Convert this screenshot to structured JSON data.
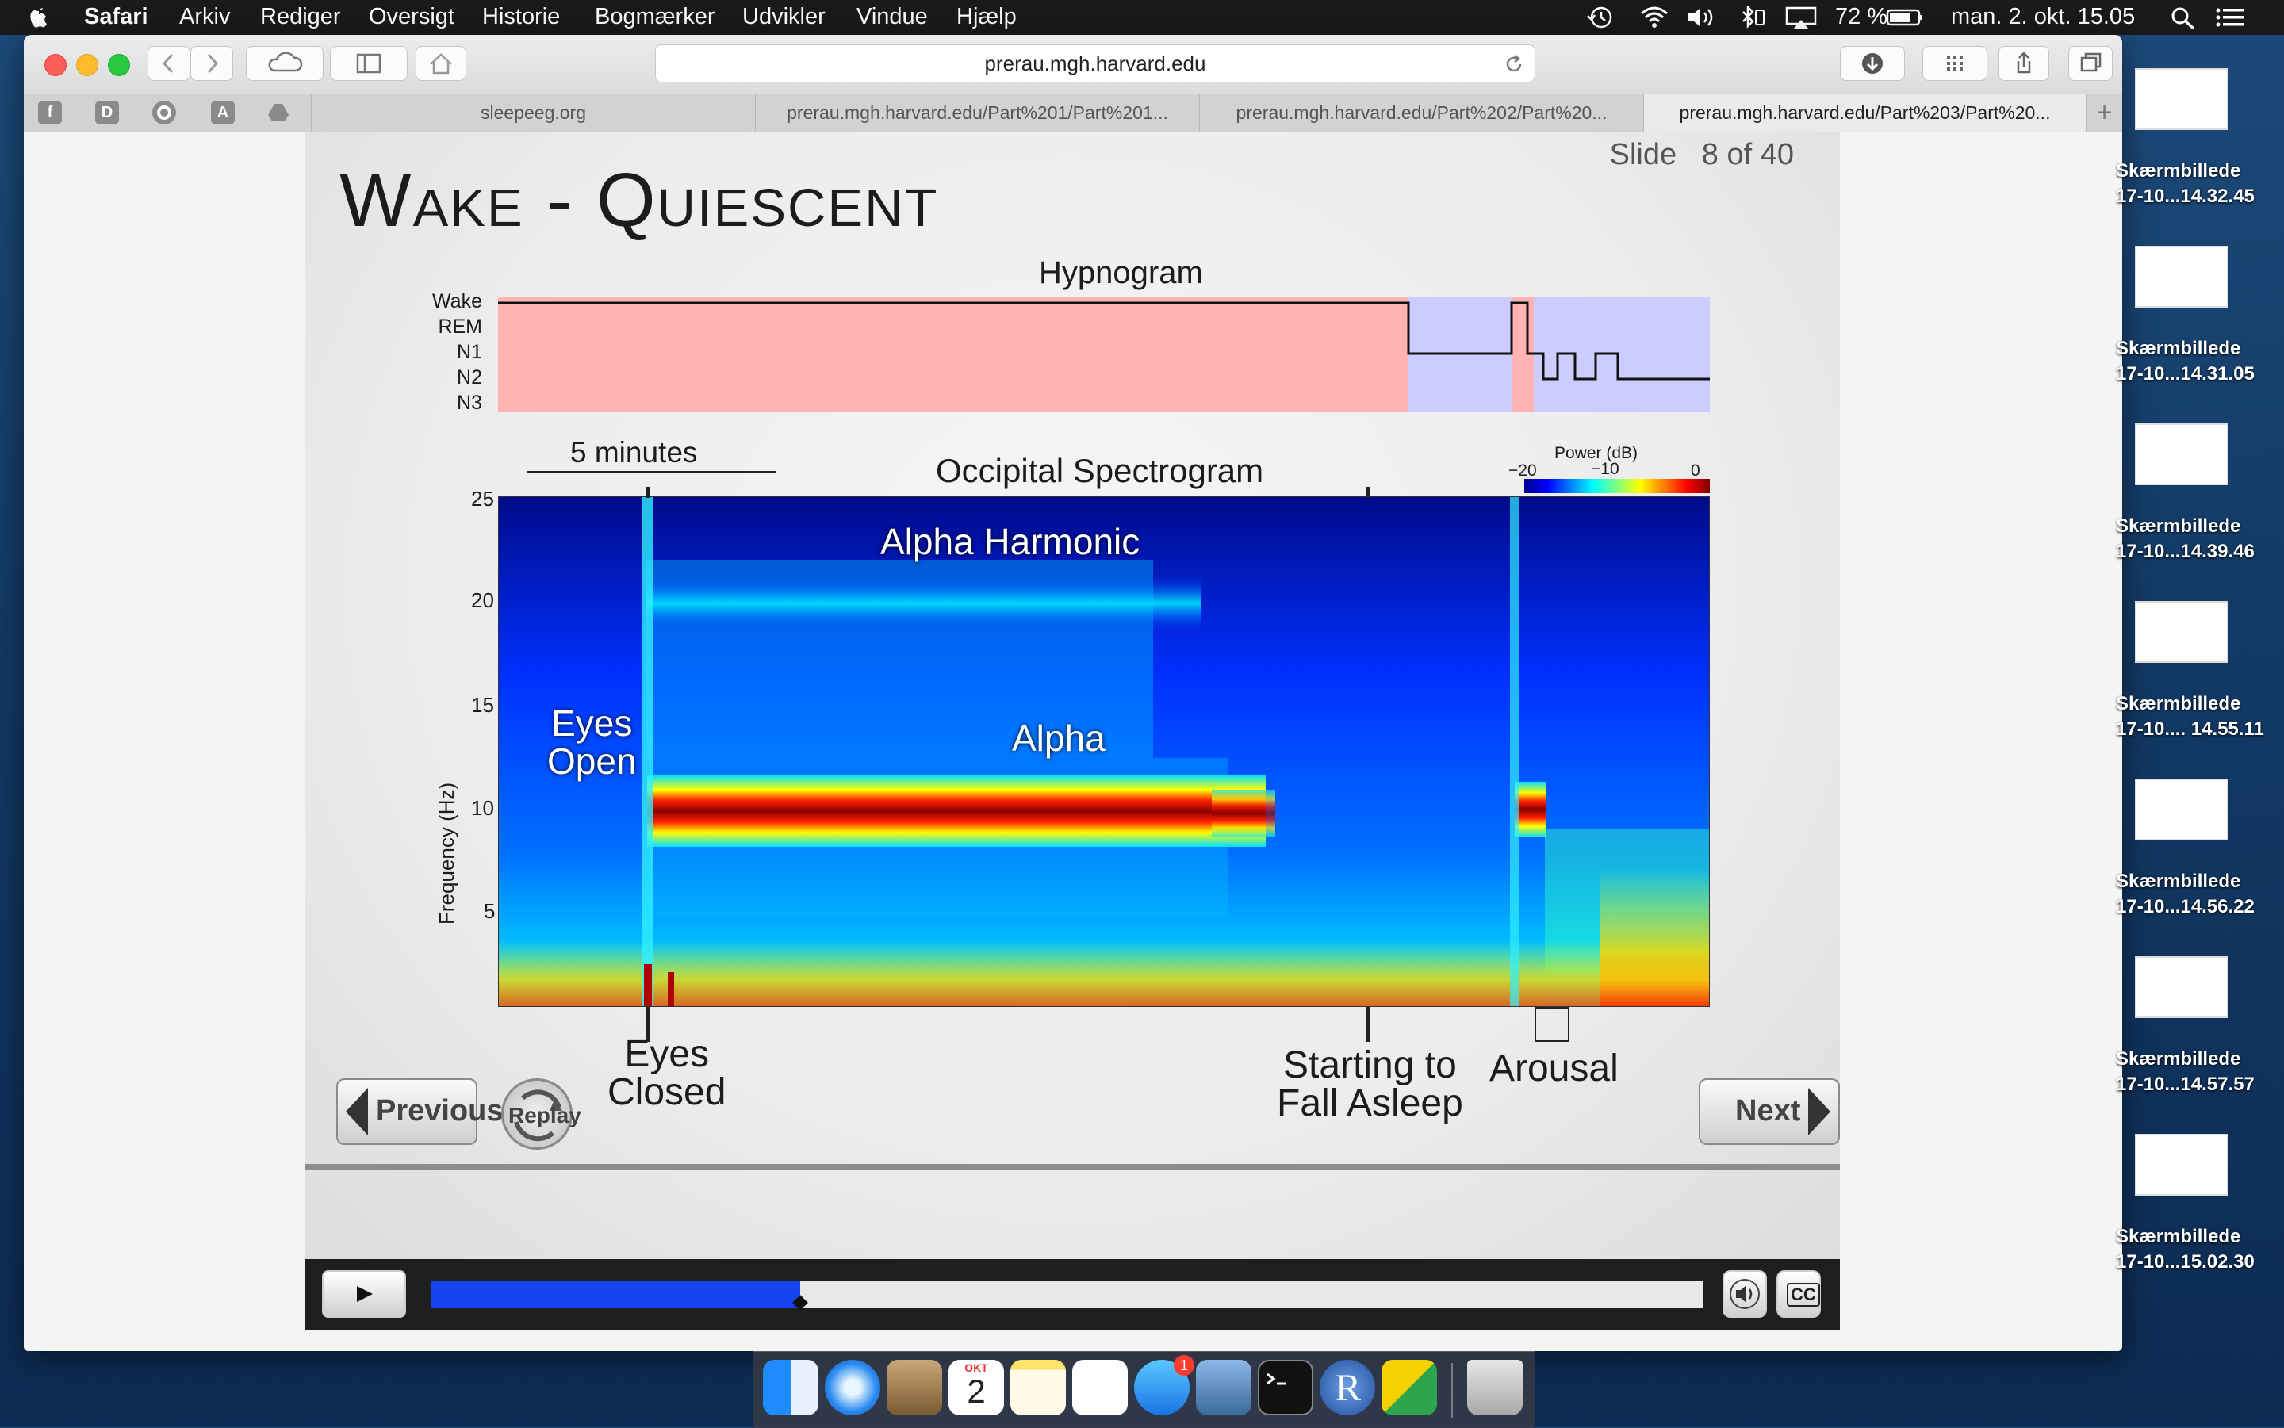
{
  "menubar": {
    "app_name": "Safari",
    "menus": [
      "Arkiv",
      "Rediger",
      "Oversigt",
      "Historie",
      "Bogmærker",
      "Udvikler",
      "Vindue",
      "Hjælp"
    ],
    "battery": "72 %",
    "clock": "man. 2. okt. 15.05"
  },
  "browser": {
    "url": "prerau.mgh.harvard.edu",
    "tabs": [
      "sleepeeg.org",
      "prerau.mgh.harvard.edu/Part%201/Part%201...",
      "prerau.mgh.harvard.edu/Part%202/Part%20...",
      "prerau.mgh.harvard.edu/Part%203/Part%20..."
    ],
    "favorites": [
      "f",
      "D",
      "",
      "A",
      ""
    ]
  },
  "slide": {
    "title": "Wake - Quiescent",
    "counter_label": "Slide",
    "counter_value": "8 of 40",
    "hypnogram_title": "Hypnogram",
    "stages": [
      "Wake",
      "REM",
      "N1",
      "N2",
      "N3"
    ],
    "scale_label": "5 minutes",
    "spectrogram_title": "Occipital Spectrogram",
    "colorbar_title": "Power (dB)",
    "colorbar_ticks": [
      "−20",
      "−10",
      "0"
    ],
    "y_axis_label": "Frequency (Hz)",
    "y_ticks": [
      "25",
      "20",
      "15",
      "10",
      "5"
    ],
    "annotations": {
      "alpha_harmonic": "Alpha Harmonic",
      "alpha": "Alpha",
      "eyes_open": [
        "Eyes",
        "Open"
      ],
      "eyes_closed": [
        "Eyes",
        "Closed"
      ],
      "starting": [
        "Starting to",
        "Fall Asleep"
      ],
      "arousal": "Arousal"
    },
    "previous_label": "Previous",
    "replay_label": "Replay",
    "next_label": "Next"
  },
  "player": {
    "progress_fraction": 0.29,
    "cc_label": "CC"
  },
  "desktop_files": [
    {
      "line1": "Skærmbillede",
      "line2": "17-10...14.32.45"
    },
    {
      "line1": "Skærmbillede",
      "line2": "17-10...14.31.05"
    },
    {
      "line1": "Skærmbillede",
      "line2": "17-10...14.39.46"
    },
    {
      "line1": "Skærmbillede",
      "line2": "17-10.... 14.55.11"
    },
    {
      "line1": "Skærmbillede",
      "line2": "17-10...14.56.22"
    },
    {
      "line1": "Skærmbillede",
      "line2": "17-10...14.57.57"
    },
    {
      "line1": "Skærmbillede",
      "line2": "17-10...15.02.30"
    }
  ],
  "dock": {
    "calendar_month": "OKT",
    "calendar_day": "2",
    "messages_badge": "1"
  },
  "colors": {
    "wake_shade": "#ffb3b3",
    "sleep_shade": "#ccccff",
    "progress": "#1543f0"
  }
}
